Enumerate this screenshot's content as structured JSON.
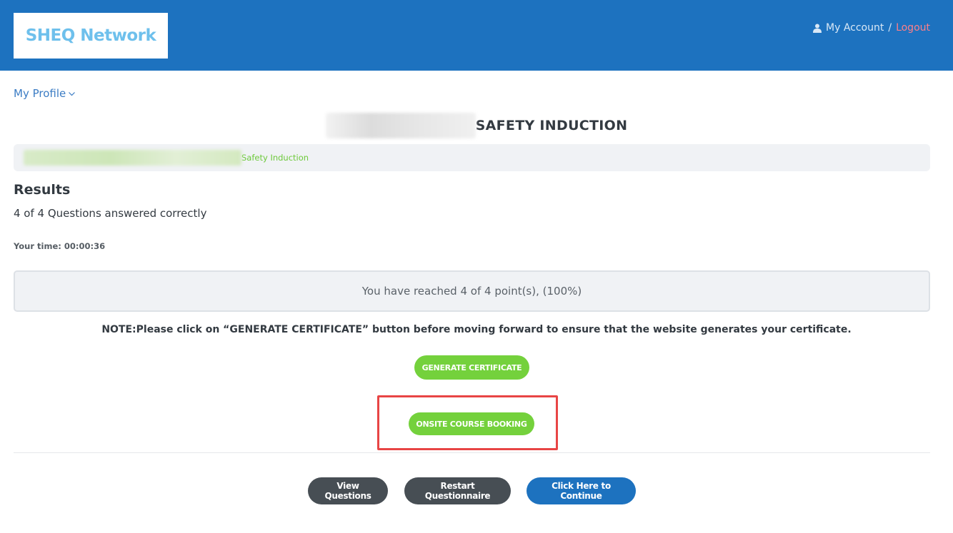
{
  "header": {
    "logo": "SHEQ Network",
    "account_label": "My Account",
    "separator": "/",
    "logout_label": "Logout"
  },
  "nav": {
    "profile_label": "My Profile"
  },
  "course": {
    "title": "SAFETY INDUCTION",
    "breadcrumb_current": "Safety Induction"
  },
  "results": {
    "heading": "Results",
    "summary": "4 of 4 Questions answered correctly",
    "time": "Your time: 00:00:36",
    "points": "You have reached 4 of 4 point(s), (100%)"
  },
  "note": "NOTE:Please click on “GENERATE CERTIFICATE” button before moving forward to ensure that the website generates your certificate.",
  "buttons": {
    "generate_certificate": "GENERATE CERTIFICATE",
    "onsite_booking": "ONSITE COURSE BOOKING",
    "view_questions": "View Questions",
    "restart": "Restart Questionnaire",
    "continue": "Click Here to Continue"
  },
  "colors": {
    "header_blue": "#1d72bf",
    "green": "#74d13c",
    "dark": "#474e54",
    "highlight": "#e84545"
  }
}
